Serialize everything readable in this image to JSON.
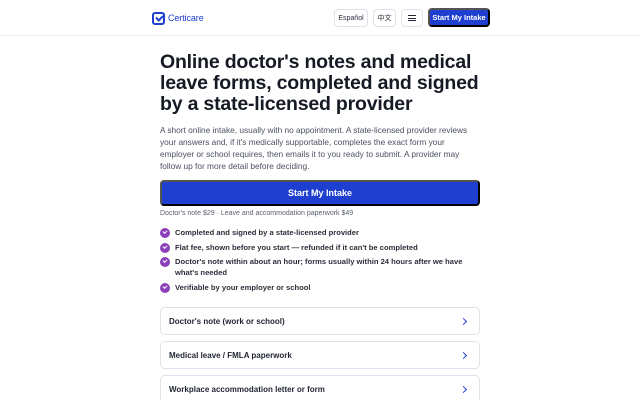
{
  "header": {
    "brand": "Certicare",
    "lang_es": "Español",
    "lang_zh": "中文",
    "cta": "Start My Intake"
  },
  "hero": {
    "title": "Online doctor's notes and medical leave forms, completed and signed by a state-licensed provider",
    "lead": "A short online intake, usually with no appointment. A state-licensed provider reviews your answers and, if it's medically supportable, completes the exact form your employer or school requires, then emails it to you ready to submit. A provider may follow up for more detail before deciding.",
    "cta": "Start My Intake",
    "prices": "Doctor's note $29 · Leave and accommodation paperwork $49"
  },
  "features": [
    "Completed and signed by a state-licensed provider",
    "Flat fee, shown before you start — refunded if it can't be completed",
    "Doctor's note within about an hour; forms usually within 24 hours after we have what's needed",
    "Verifiable by your employer or school"
  ],
  "options": [
    "Doctor's note (work or school)",
    "Medical leave / FMLA paperwork",
    "Workplace accommodation letter or form"
  ],
  "colors": {
    "accent": "#1f3fd1",
    "check": "#8b3fb8"
  }
}
